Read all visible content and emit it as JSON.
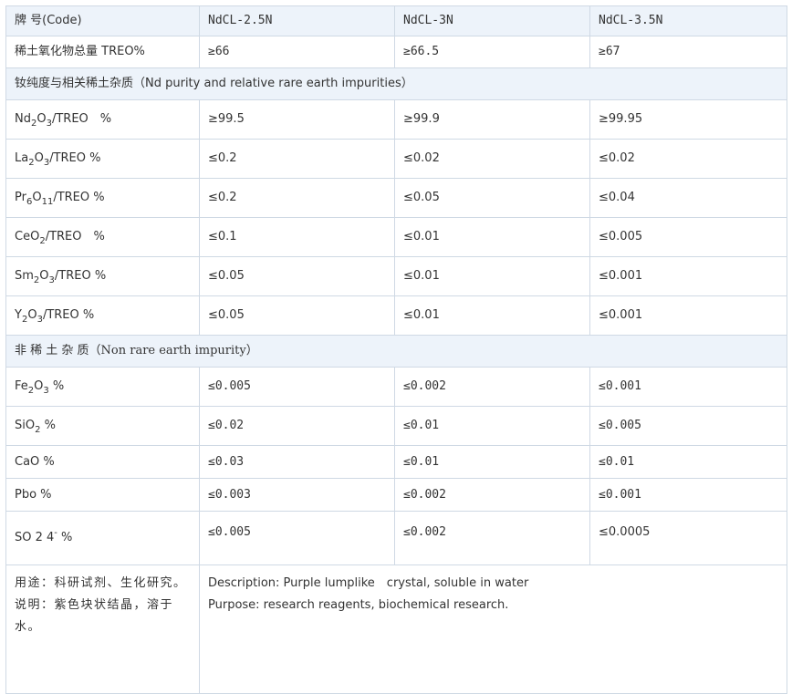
{
  "header": {
    "code_label": "牌 号(Code)",
    "grades": [
      "NdCL-2.5N",
      "NdCL-3N",
      "NdCL-3.5N"
    ]
  },
  "treo": {
    "label": "稀土氧化物总量 TREO%",
    "values": [
      "≥66",
      "≥66.5",
      "≥67"
    ]
  },
  "section_re": {
    "title": "钕纯度与相关稀土杂质（Nd purity and relative rare earth impurities）"
  },
  "re_rows": [
    {
      "name": "nd2o3",
      "base": "Nd",
      "s1": "2",
      "mid": "O",
      "s2": "3",
      "suffix": "/TREO　%",
      "values": [
        "≥99.5",
        "≥99.9",
        "≥99.95"
      ]
    },
    {
      "name": "la2o3",
      "base": "La",
      "s1": "2",
      "mid": "O",
      "s2": "3",
      "suffix": "/TREO %",
      "values": [
        "≤0.2",
        "≤0.02",
        "≤0.02"
      ]
    },
    {
      "name": "pr6o11",
      "base": "Pr",
      "s1": "6",
      "mid": "O",
      "s2": "11",
      "suffix": "/TREO %",
      "values": [
        "≤0.2",
        "≤0.05",
        "≤0.04"
      ]
    },
    {
      "name": "ceo2",
      "base": "CeO",
      "s1": "2",
      "mid": "",
      "s2": "",
      "suffix": "/TREO　%",
      "values": [
        "≤0.1",
        "≤0.01",
        "≤0.005"
      ]
    },
    {
      "name": "sm2o3",
      "base": "Sm",
      "s1": "2",
      "mid": "O",
      "s2": "3",
      "suffix": "/TREO %",
      "values": [
        "≤0.05",
        "≤0.01",
        "≤0.001"
      ]
    },
    {
      "name": "y2o3",
      "base": "Y",
      "s1": "2",
      "mid": "O",
      "s2": "3",
      "suffix": "/TREO %",
      "values": [
        "≤0.05",
        "≤0.01",
        "≤0.001"
      ]
    }
  ],
  "section_non": {
    "title": "非 稀 土 杂 质（Non rare earth impurity）"
  },
  "non_rows": [
    {
      "name": "fe2o3",
      "base": "Fe",
      "s1": "2",
      "mid": "O",
      "s2": "3",
      "suffix": " %",
      "values": [
        "≤0.005",
        "≤0.002",
        "≤0.001"
      ]
    },
    {
      "name": "sio2",
      "base": "SiO",
      "s1": "2",
      "mid": "",
      "s2": "",
      "suffix": " %",
      "values": [
        "≤0.02",
        "≤0.01",
        "≤0.005"
      ]
    },
    {
      "name": "cao",
      "base": "CaO",
      "s1": "",
      "mid": "",
      "s2": "",
      "suffix": " %",
      "values": [
        "≤0.03",
        "≤0.01",
        "≤0.01"
      ]
    },
    {
      "name": "pbo",
      "base": "Pbo",
      "s1": "",
      "mid": "",
      "s2": "",
      "suffix": " %",
      "values": [
        "≤0.003",
        "≤0.002",
        "≤0.001"
      ]
    }
  ],
  "so4": {
    "base": "SO 2 4",
    "sup": "-",
    "suffix": " %",
    "values": [
      "≤0.005",
      "≤0.002",
      "≤0.0005"
    ]
  },
  "footer": {
    "usage_cn": "用途：科研试剂、生化研究。",
    "desc_cn": "说明：紫色块状结晶，溶于水。",
    "desc_en": "Description: Purple lumplike　crystal, soluble in water",
    "purpose_en": "Purpose: research reagents, biochemical research."
  }
}
